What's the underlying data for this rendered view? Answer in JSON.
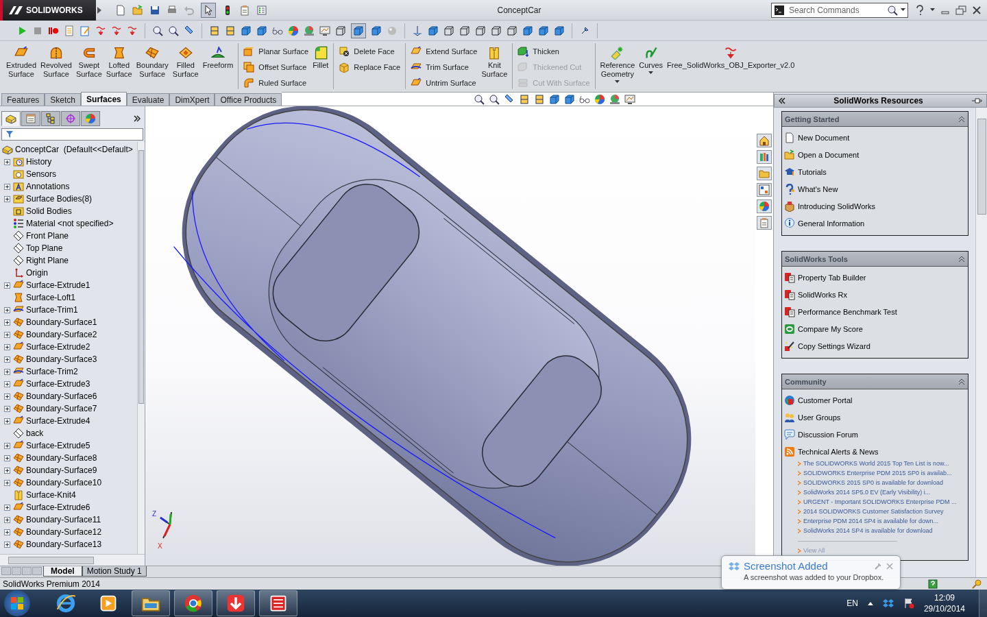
{
  "title_bar": {
    "logo": "SOLIDWORKS",
    "title": "ConceptCar",
    "search": {
      "placeholder": "Search Commands"
    }
  },
  "quick_access": [
    {
      "kind": "new",
      "pressed": false
    },
    {
      "kind": "open",
      "pressed": false
    },
    {
      "kind": "save",
      "pressed": false
    },
    {
      "kind": "print",
      "pressed": false
    },
    {
      "kind": "undo",
      "pressed": false
    },
    {
      "kind": "pointer",
      "pressed": true
    },
    {
      "kind": "rebuild",
      "pressed": false
    },
    {
      "kind": "props",
      "pressed": false
    },
    {
      "kind": "options",
      "pressed": false
    }
  ],
  "toolbar_groups": [
    {
      "items": [
        {
          "kind": "play",
          "pressed": false
        },
        {
          "kind": "stop",
          "pressed": false
        },
        {
          "kind": "record",
          "pressed": false
        },
        {
          "kind": "macro",
          "pressed": false
        },
        {
          "kind": "macro-edit",
          "pressed": false
        },
        {
          "kind": "obj",
          "pressed": false
        },
        {
          "kind": "obj",
          "pressed": false
        },
        {
          "kind": "obj",
          "pressed": false
        }
      ]
    },
    {
      "items": [
        {
          "kind": "zoom",
          "pressed": false
        },
        {
          "kind": "zoom",
          "pressed": false
        },
        {
          "kind": "prev",
          "pressed": false
        }
      ]
    },
    {
      "items": [
        {
          "kind": "section",
          "pressed": false
        },
        {
          "kind": "section",
          "pressed": false
        },
        {
          "kind": "orient",
          "pressed": false
        },
        {
          "kind": "cube",
          "pressed": false
        },
        {
          "kind": "glasses",
          "pressed": false
        },
        {
          "kind": "appearance",
          "pressed": false
        },
        {
          "kind": "scene",
          "pressed": false
        },
        {
          "kind": "settings",
          "pressed": false
        },
        {
          "kind": "wire",
          "pressed": false
        },
        {
          "kind": "shaded",
          "pressed": true
        },
        {
          "kind": "shaded",
          "pressed": false
        },
        {
          "kind": "real",
          "pressed": false
        }
      ]
    },
    {
      "items": [
        {
          "kind": "normal",
          "pressed": false
        },
        {
          "kind": "cube",
          "pressed": false
        },
        {
          "kind": "wire",
          "pressed": false
        },
        {
          "kind": "wire",
          "pressed": false
        },
        {
          "kind": "wire",
          "pressed": false
        },
        {
          "kind": "wire",
          "pressed": false
        },
        {
          "kind": "wire",
          "pressed": false
        },
        {
          "kind": "cube",
          "pressed": false
        },
        {
          "kind": "cube",
          "pressed": false
        },
        {
          "kind": "cube",
          "pressed": false
        }
      ]
    },
    {
      "items": [
        {
          "kind": "sensor",
          "pressed": false
        }
      ]
    }
  ],
  "ribbon": [
    {
      "kind": "large",
      "items": [
        {
          "kind": "extrude",
          "label": "Extruded Surface",
          "dropdown": false,
          "disabled": false
        },
        {
          "kind": "revolve",
          "label": "Revolved Surface",
          "dropdown": false,
          "disabled": false
        },
        {
          "kind": "sweep",
          "label": "Swept Surface",
          "dropdown": false,
          "disabled": false
        },
        {
          "kind": "loft",
          "label": "Lofted Surface",
          "dropdown": false,
          "disabled": false
        },
        {
          "kind": "boundary",
          "label": "Boundary Surface",
          "dropdown": false,
          "disabled": false
        },
        {
          "kind": "fill",
          "label": "Filled Surface",
          "dropdown": false,
          "disabled": false
        },
        {
          "kind": "freeform",
          "label": "Freeform",
          "dropdown": false,
          "disabled": false
        }
      ]
    },
    {
      "kind": "divider"
    },
    {
      "kind": "stack",
      "items": [
        {
          "kind": "planar",
          "label": "Planar Surface",
          "disabled": false
        },
        {
          "kind": "offset",
          "label": "Offset Surface",
          "disabled": false
        },
        {
          "kind": "ruled",
          "label": "Ruled Surface",
          "disabled": false
        }
      ]
    },
    {
      "kind": "large",
      "items": [
        {
          "kind": "fillet",
          "label": "Fillet",
          "dropdown": false,
          "disabled": false
        }
      ]
    },
    {
      "kind": "divider"
    },
    {
      "kind": "stack",
      "items": [
        {
          "kind": "delete-face",
          "label": "Delete Face",
          "disabled": false
        },
        {
          "kind": "replace-face",
          "label": "Replace Face",
          "disabled": false
        }
      ]
    },
    {
      "kind": "divider"
    },
    {
      "kind": "stack",
      "items": [
        {
          "kind": "extend",
          "label": "Extend Surface",
          "disabled": false
        },
        {
          "kind": "trim",
          "label": "Trim Surface",
          "disabled": false
        },
        {
          "kind": "untrim",
          "label": "Untrim Surface",
          "disabled": false
        }
      ]
    },
    {
      "kind": "large",
      "items": [
        {
          "kind": "knit",
          "label": "Knit Surface",
          "dropdown": false,
          "disabled": false
        }
      ]
    },
    {
      "kind": "divider"
    },
    {
      "kind": "stack",
      "items": [
        {
          "kind": "thicken",
          "label": "Thicken",
          "disabled": false
        },
        {
          "kind": "thicken-cut",
          "label": "Thickened Cut",
          "disabled": true
        },
        {
          "kind": "cut-surface",
          "label": "Cut With Surface",
          "disabled": true
        }
      ]
    },
    {
      "kind": "divider"
    },
    {
      "kind": "large",
      "items": [
        {
          "kind": "ref",
          "label": "Reference Geometry",
          "dropdown": true,
          "disabled": false
        },
        {
          "kind": "curves",
          "label": "Curves",
          "dropdown": true,
          "disabled": false
        },
        {
          "kind": "obj",
          "label": "Free_SolidWorks_OBJ_Exporter_v2.0",
          "dropdown": false,
          "disabled": false
        }
      ]
    }
  ],
  "command_tabs": [
    {
      "label": "Features",
      "selected": false
    },
    {
      "label": "Sketch",
      "selected": false
    },
    {
      "label": "Surfaces",
      "selected": true
    },
    {
      "label": "Evaluate",
      "selected": false
    },
    {
      "label": "DimXpert",
      "selected": false
    },
    {
      "label": "Office Products",
      "selected": false
    }
  ],
  "heads_up_toolbar": [
    {
      "kind": "zoom"
    },
    {
      "kind": "zoom"
    },
    {
      "kind": "prev"
    },
    {
      "kind": "section"
    },
    {
      "kind": "section"
    },
    {
      "kind": "orient"
    },
    {
      "kind": "cube"
    },
    {
      "kind": "glasses"
    },
    {
      "kind": "appearance"
    },
    {
      "kind": "scene"
    },
    {
      "kind": "settings"
    }
  ],
  "feature_manager": {
    "tabs": [
      {
        "kind": "tree",
        "selected": true
      },
      {
        "kind": "property",
        "selected": false
      },
      {
        "kind": "config",
        "selected": false
      },
      {
        "kind": "dimxpert",
        "selected": false
      },
      {
        "kind": "display",
        "selected": false
      }
    ],
    "tree": {
      "label": "ConceptCar  (Default<<Default>",
      "kind": "part",
      "children": [
        {
          "label": "History",
          "kind": "history",
          "expandable": true
        },
        {
          "label": "Sensors",
          "kind": "sensors",
          "expandable": false
        },
        {
          "label": "Annotations",
          "kind": "annotations",
          "expandable": true
        },
        {
          "label": "Surface Bodies(8)",
          "kind": "bodies",
          "expandable": true
        },
        {
          "label": "Solid Bodies",
          "kind": "solid-bodies",
          "expandable": false
        },
        {
          "label": "Material <not specified>",
          "kind": "material",
          "expandable": false
        },
        {
          "label": "Front Plane",
          "kind": "plane",
          "expandable": false
        },
        {
          "label": "Top Plane",
          "kind": "plane",
          "expandable": false
        },
        {
          "label": "Right Plane",
          "kind": "plane",
          "expandable": false
        },
        {
          "label": "Origin",
          "kind": "origin",
          "expandable": false
        },
        {
          "label": "Surface-Extrude1",
          "kind": "extrude",
          "expandable": true
        },
        {
          "label": "Surface-Loft1",
          "kind": "loft",
          "expandable": false
        },
        {
          "label": "Surface-Trim1",
          "kind": "trim",
          "expandable": true
        },
        {
          "label": "Boundary-Surface1",
          "kind": "boundary",
          "expandable": true
        },
        {
          "label": "Boundary-Surface2",
          "kind": "boundary",
          "expandable": true
        },
        {
          "label": "Surface-Extrude2",
          "kind": "extrude",
          "expandable": true
        },
        {
          "label": "Boundary-Surface3",
          "kind": "boundary",
          "expandable": true
        },
        {
          "label": "Surface-Trim2",
          "kind": "trim",
          "expandable": true
        },
        {
          "label": "Surface-Extrude3",
          "kind": "extrude",
          "expandable": true
        },
        {
          "label": "Boundary-Surface6",
          "kind": "boundary",
          "expandable": true
        },
        {
          "label": "Boundary-Surface7",
          "kind": "boundary",
          "expandable": true
        },
        {
          "label": "Surface-Extrude4",
          "kind": "extrude",
          "expandable": true
        },
        {
          "label": "back",
          "kind": "plane",
          "expandable": false
        },
        {
          "label": "Surface-Extrude5",
          "kind": "extrude",
          "expandable": true
        },
        {
          "label": "Boundary-Surface8",
          "kind": "boundary",
          "expandable": true
        },
        {
          "label": "Boundary-Surface9",
          "kind": "boundary",
          "expandable": true
        },
        {
          "label": "Boundary-Surface10",
          "kind": "boundary",
          "expandable": true
        },
        {
          "label": "Surface-Knit4",
          "kind": "knit",
          "expandable": false
        },
        {
          "label": "Surface-Extrude6",
          "kind": "extrude",
          "expandable": true
        },
        {
          "label": "Boundary-Surface11",
          "kind": "boundary",
          "expandable": true
        },
        {
          "label": "Boundary-Surface12",
          "kind": "boundary",
          "expandable": true
        },
        {
          "label": "Boundary-Surface13",
          "kind": "boundary",
          "expandable": true
        }
      ]
    }
  },
  "model_tabs": [
    {
      "label": "Model",
      "selected": true
    },
    {
      "label": "Motion Study 1",
      "selected": false
    }
  ],
  "triad": [
    "Z",
    "X"
  ],
  "side_tabs": [
    {
      "kind": "home"
    },
    {
      "kind": "library"
    },
    {
      "kind": "folder"
    },
    {
      "kind": "palette"
    },
    {
      "kind": "appearance"
    },
    {
      "kind": "props"
    }
  ],
  "task_pane": {
    "title": "SolidWorks Resources",
    "sections": [
      {
        "title": "Getting Started",
        "expanded": true,
        "items": [
          {
            "label": "New Document",
            "kind": "new"
          },
          {
            "label": "Open a Document",
            "kind": "open"
          },
          {
            "label": "Tutorials",
            "kind": "tutorials"
          },
          {
            "label": "What's New",
            "kind": "whats-new"
          },
          {
            "label": "Introducing SolidWorks",
            "kind": "intro"
          },
          {
            "label": "General Information",
            "kind": "info"
          }
        ]
      },
      {
        "title": "SolidWorks Tools",
        "expanded": true,
        "items": [
          {
            "label": "Property Tab Builder",
            "kind": "app"
          },
          {
            "label": "SolidWorks Rx",
            "kind": "app"
          },
          {
            "label": "Performance Benchmark Test",
            "kind": "app"
          },
          {
            "label": "Compare My Score",
            "kind": "compare"
          },
          {
            "label": "Copy Settings Wizard",
            "kind": "wand"
          }
        ]
      },
      {
        "title": "Community",
        "expanded": true,
        "items": [
          {
            "label": "Customer Portal",
            "kind": "globe"
          },
          {
            "label": "User Groups",
            "kind": "people"
          },
          {
            "label": "Discussion Forum",
            "kind": "forum"
          },
          {
            "label": "Technical Alerts & News",
            "kind": "rss"
          }
        ],
        "news": [
          "The SOLIDWORKS World 2015 Top Ten List is now...",
          "SOLIDWORKS Enterprise PDM 2015 SP0 is availab...",
          "SOLIDWORKS 2015 SP0 is available for download",
          "SolidWorks 2014 SP5.0 EV (Early Visibility) i...",
          "URGENT - Important SOLIDWORKS Enterprise PDM ...",
          "2014 SOLIDWORKS Customer Satisfaction Survey",
          "Enterprise PDM 2014 SP4 is available for down...",
          "SolidWorks 2014 SP4 is available for download"
        ],
        "view_all": "View All"
      }
    ]
  },
  "status_bar": {
    "text": "SolidWorks Premium 2014"
  },
  "notification": {
    "title": "Screenshot Added",
    "message": "A screenshot was added to your Dropbox."
  },
  "taskbar": {
    "apps": [
      {
        "kind": "ie",
        "running": false
      },
      {
        "kind": "media",
        "running": false
      },
      {
        "kind": "explorer",
        "running": true
      },
      {
        "kind": "chrome",
        "running": true
      },
      {
        "kind": "download",
        "running": true
      },
      {
        "kind": "sw",
        "running": true
      }
    ],
    "language": "EN",
    "time": "12:09",
    "date": "29/10/2014"
  }
}
